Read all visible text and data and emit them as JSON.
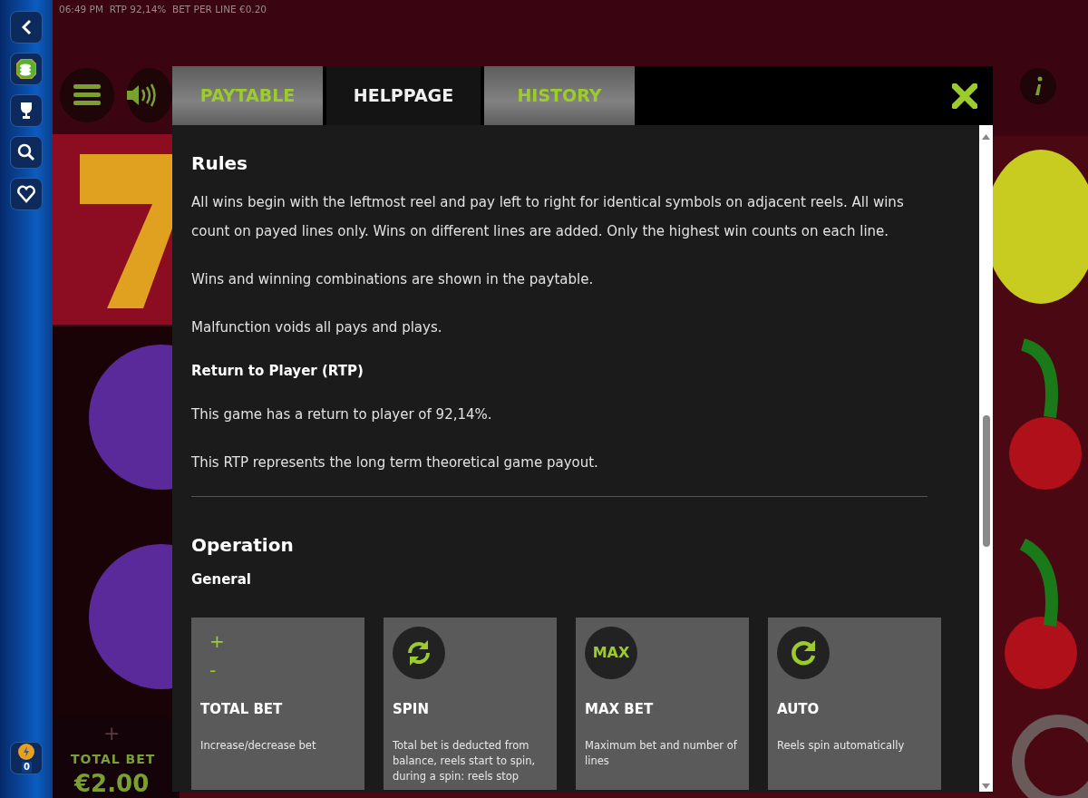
{
  "status_line": "06:49 PM  RTP 92,14%  BET PER LINE €0.20",
  "sidebar": {
    "coin_count": "0"
  },
  "game": {
    "plus": "+",
    "total_bet_label": "TOTAL BET",
    "total_bet_value": "€2.00"
  },
  "dialog": {
    "tabs": [
      {
        "label": "PAYTABLE",
        "selected": false
      },
      {
        "label": "HELPPAGE",
        "selected": true
      },
      {
        "label": "HISTORY",
        "selected": false
      }
    ],
    "blocks": [
      {
        "kind": "heading",
        "text": "Rules"
      },
      {
        "kind": "paragraph",
        "text": "All wins begin with the leftmost reel and pay left to right for identical symbols on adjacent reels. All wins count on payed lines only. Wins on different lines are added. Only the highest win counts on each line."
      },
      {
        "kind": "paragraph",
        "text": "Wins and winning combinations are shown in the paytable."
      },
      {
        "kind": "paragraph",
        "text": "Malfunction voids all pays and plays."
      },
      {
        "kind": "subheading",
        "text": "Return to Player (RTP)"
      },
      {
        "kind": "paragraph",
        "text": "This game has a return to player of 92,14%."
      },
      {
        "kind": "paragraph",
        "text": "This RTP represents the long term theoretical game payout."
      },
      {
        "kind": "divider"
      },
      {
        "kind": "heading",
        "text": "Operation"
      },
      {
        "kind": "subheading",
        "text": "General"
      }
    ],
    "cards": [
      {
        "kind": "plusminus",
        "plus": "+",
        "minus": "-",
        "title": "TOTAL BET",
        "text": "Increase/decrease bet"
      },
      {
        "kind": "spin",
        "title": "SPIN",
        "text": "Total bet is deducted from balance, reels start to spin, during a spin: reels stop"
      },
      {
        "kind": "max",
        "icon_text": "MAX",
        "title": "MAX BET",
        "text": "Maximum bet and number of lines"
      },
      {
        "kind": "auto",
        "title": "AUTO",
        "text": "Reels spin automatically"
      }
    ]
  }
}
